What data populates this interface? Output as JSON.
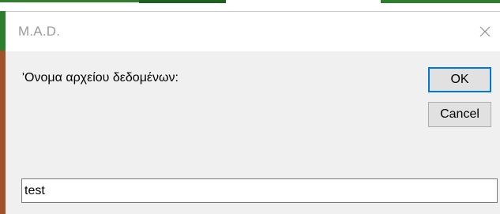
{
  "dialog": {
    "title": "M.A.D.",
    "close_icon": "close-icon",
    "prompt": "'Ονομα αρχείου δεδομένων:",
    "ok_label": "OK",
    "cancel_label": "Cancel",
    "filename_value": "test"
  },
  "colors": {
    "accent_green": "#2f7d2f",
    "accent_brown": "#a0522d",
    "focus_blue": "#0078d7",
    "dialog_bg": "#f0f0f0"
  }
}
